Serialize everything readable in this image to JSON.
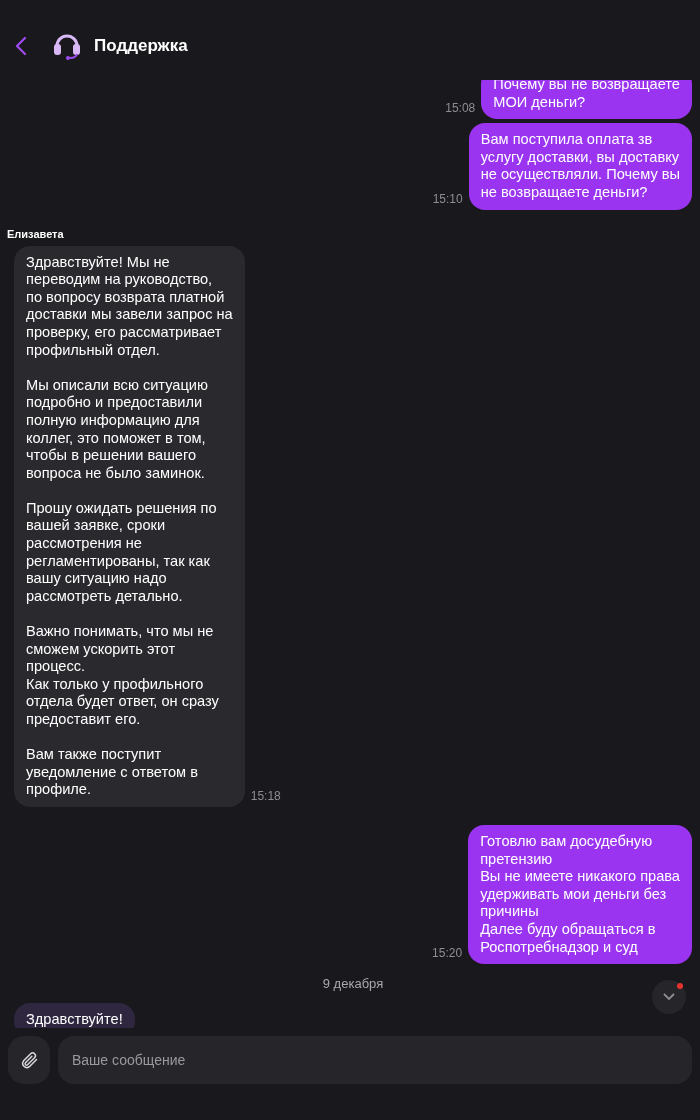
{
  "header": {
    "title": "Поддержка"
  },
  "messages": [
    {
      "kind": "outgoing",
      "text": "Почему вы не возвращаете\nМОИ деньги?",
      "time": "15:08"
    },
    {
      "kind": "outgoing",
      "text": "Вам поступила оплата зв\nуслугу доставки, вы доставку\nне осуществляли. Почему вы\nне возвращаете деньги?",
      "time": "15:10"
    },
    {
      "kind": "incoming",
      "sender": "Елизавета",
      "text": "Здравствуйте! Мы не\nпереводим на руководство,\nпо вопросу возврата платной\nдоставки мы завели запрос на\nпроверку, его рассматривает\nпрофильный отдел.\n\nМы описали всю ситуацию\nподробно и предоставили\nполную информацию для\nколлег, это поможет в том,\nчтобы в решении вашего\nвопроса не было заминок.\n\nПрошу ожидать решения по\nвашей заявке, сроки\nрассмотрения не\nрегламентированы, так как\nвашу ситуацию надо\nрассмотреть детально.\n\nВажно понимать, что мы не\nсможем ускорить этот\nпроцесс.\nКак только у профильного\nотдела будет ответ, он сразу\nпредоставит его.\n\nВам также поступит\nуведомление с ответом в\nпрофиле.",
      "time": "15:18",
      "highlighted": false
    },
    {
      "kind": "outgoing",
      "text": "Готовлю вам досудебную\nпретензию\nВы не имеете никакого права\nудерживать мои деньги без\nпричины\nДалее буду обращаться в\nРоспотребнадзор и суд",
      "time": "15:20"
    },
    {
      "kind": "date",
      "text": "9 декабря"
    },
    {
      "kind": "incoming",
      "text": "Здравствуйте!",
      "highlighted": true
    }
  ],
  "scroll_button": {
    "unread": true
  },
  "composer": {
    "placeholder": "Ваше сообщение"
  }
}
